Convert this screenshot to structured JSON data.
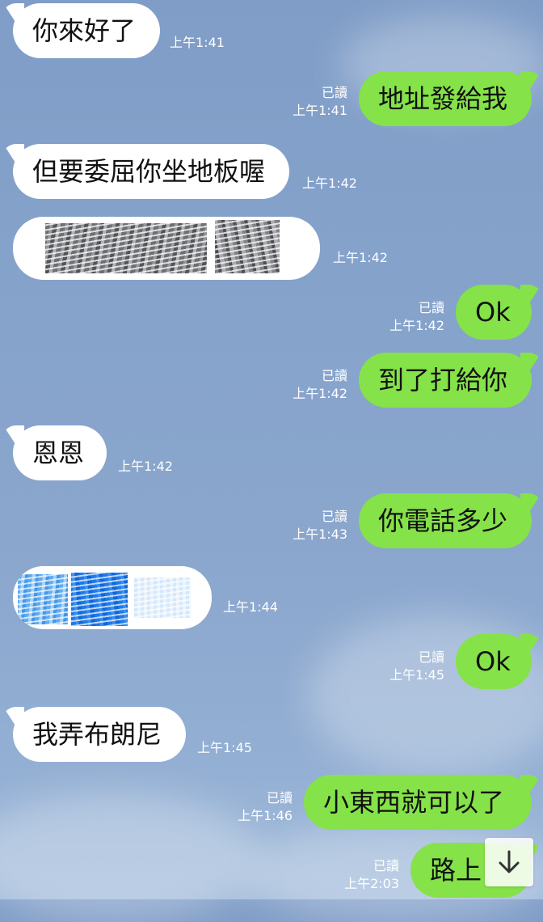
{
  "messages": [
    {
      "side": "in",
      "text": "你來好了",
      "time": "上午1:41"
    },
    {
      "side": "out",
      "text": "地址發給我",
      "read": "已讀",
      "time": "上午1:41"
    },
    {
      "side": "in",
      "text": "但要委屈你坐地板喔",
      "time": "上午1:42"
    },
    {
      "side": "in",
      "text": "",
      "time": "上午1:42"
    },
    {
      "side": "out",
      "text": "Ok",
      "read": "已讀",
      "time": "上午1:42"
    },
    {
      "side": "out",
      "text": "到了打給你",
      "read": "已讀",
      "time": "上午1:42"
    },
    {
      "side": "in",
      "text": "恩恩",
      "time": "上午1:42"
    },
    {
      "side": "out",
      "text": "你電話多少",
      "read": "已讀",
      "time": "上午1:43"
    },
    {
      "side": "in",
      "text": "",
      "time": "上午1:44"
    },
    {
      "side": "out",
      "text": "Ok",
      "read": "已讀",
      "time": "上午1:45"
    },
    {
      "side": "in",
      "text": "我弄布朗尼",
      "time": "上午1:45"
    },
    {
      "side": "out",
      "text": "小東西就可以了",
      "read": "已讀",
      "time": "上午1:46"
    },
    {
      "side": "out",
      "text": "路上",
      "read": "已讀",
      "time": "上午2:03"
    }
  ],
  "controls": {
    "scroll_down_icon": "arrow-down-icon"
  }
}
